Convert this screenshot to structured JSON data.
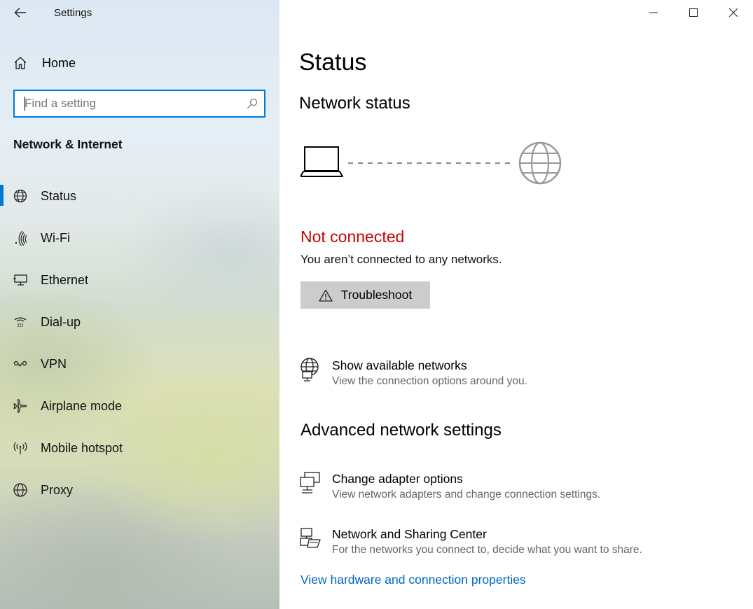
{
  "window": {
    "app_title": "Settings",
    "controls": {
      "minimize_icon": "minimize-icon",
      "maximize_icon": "maximize-icon",
      "close_icon": "close-icon"
    }
  },
  "sidebar": {
    "home_label": "Home",
    "search": {
      "placeholder": "Find a setting",
      "value": ""
    },
    "section_title": "Network & Internet",
    "items": [
      {
        "label": "Status",
        "icon": "globe-status-icon",
        "active": true
      },
      {
        "label": "Wi-Fi",
        "icon": "wifi-icon",
        "active": false
      },
      {
        "label": "Ethernet",
        "icon": "ethernet-icon",
        "active": false
      },
      {
        "label": "Dial-up",
        "icon": "dialup-icon",
        "active": false
      },
      {
        "label": "VPN",
        "icon": "vpn-icon",
        "active": false
      },
      {
        "label": "Airplane mode",
        "icon": "airplane-icon",
        "active": false
      },
      {
        "label": "Mobile hotspot",
        "icon": "hotspot-icon",
        "active": false
      },
      {
        "label": "Proxy",
        "icon": "globe-icon",
        "active": false
      }
    ]
  },
  "main": {
    "page_title": "Status",
    "network_status_title": "Network status",
    "status_heading": "Not connected",
    "status_description": "You aren’t connected to any networks.",
    "troubleshoot_label": "Troubleshoot",
    "show_networks": {
      "title": "Show available networks",
      "description": "View the connection options around you."
    },
    "advanced_title": "Advanced network settings",
    "change_adapter": {
      "title": "Change adapter options",
      "description": "View network adapters and change connection settings."
    },
    "sharing_center": {
      "title": "Network and Sharing Center",
      "description": "For the networks you connect to, decide what you want to share."
    },
    "hardware_link": "View hardware and connection properties"
  },
  "colors": {
    "accent": "#0078d7",
    "link": "#0067c0",
    "error": "#c50500",
    "button_bg": "#cccccc"
  }
}
